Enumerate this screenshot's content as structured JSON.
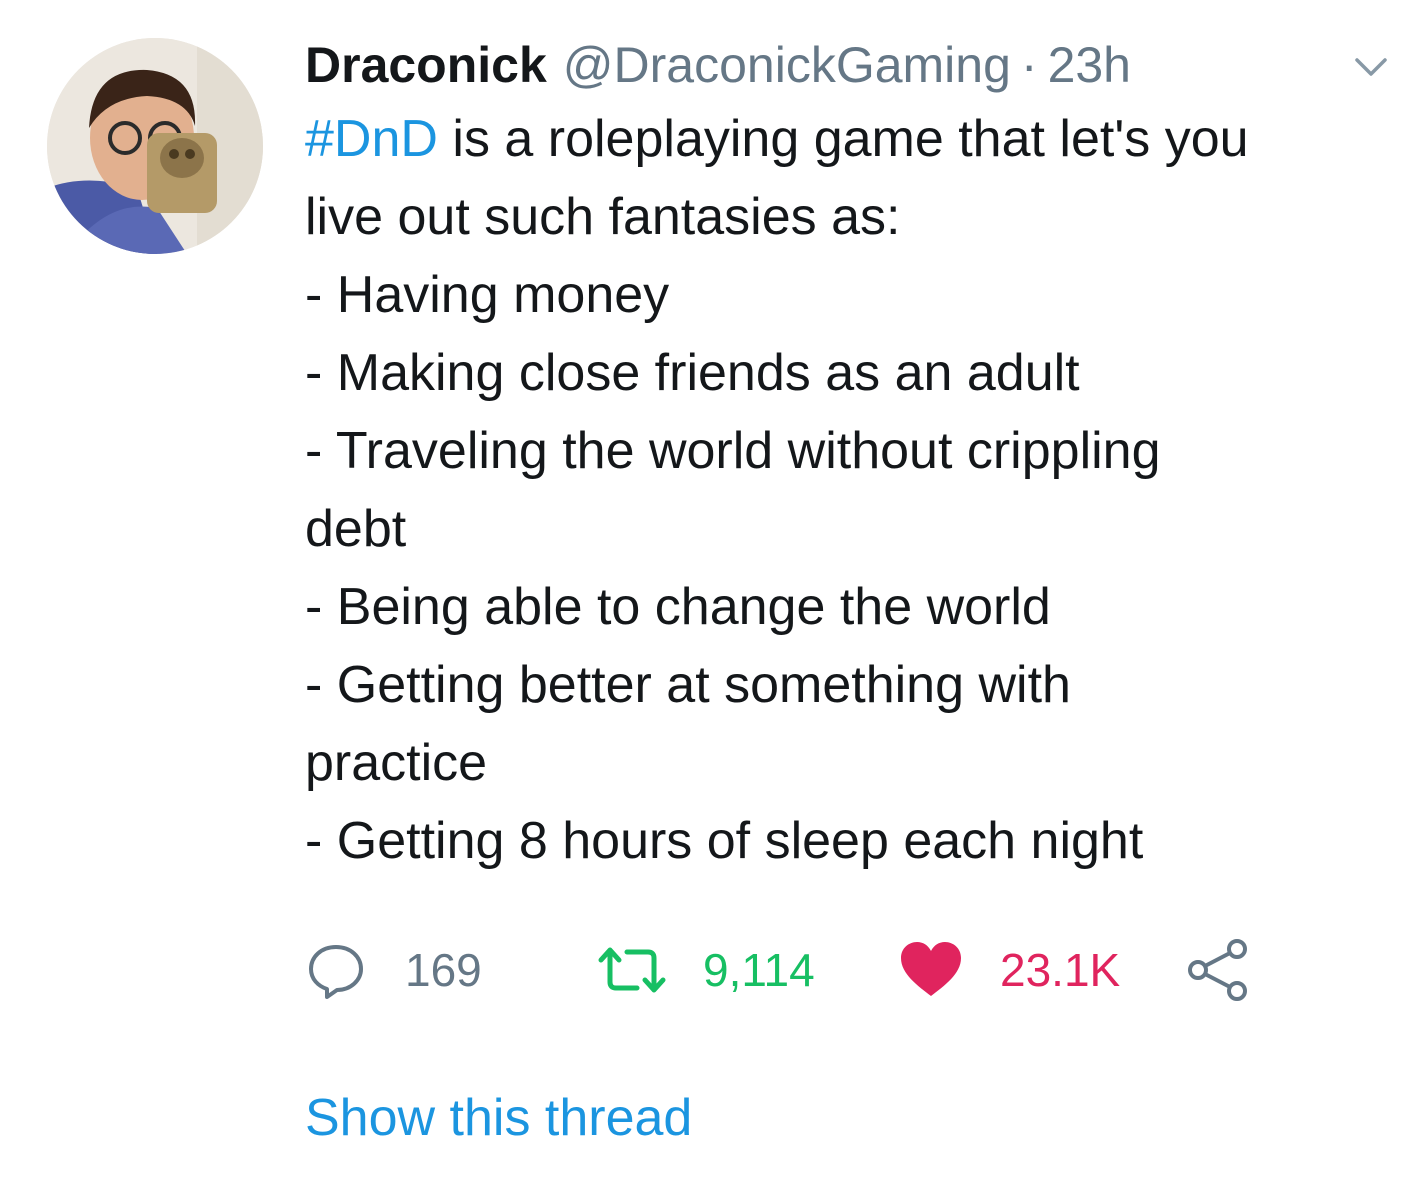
{
  "author": {
    "name": "Draconick",
    "handle": "@DraconickGaming",
    "separator": "·",
    "time": "23h"
  },
  "tweet": {
    "hashtag": "#DnD",
    "lines": {
      "l1_rest": " is a roleplaying game that let's you",
      "l2": "live out such fantasies as:",
      "l3": "- Having money",
      "l4": "- Making close friends as an adult",
      "l5": "- Traveling the world without crippling",
      "l6": "debt",
      "l7": "- Being able to change the world",
      "l8": "- Getting better at something with",
      "l9": "practice",
      "l10": "- Getting 8 hours of sleep each night"
    }
  },
  "actions": {
    "replies": "169",
    "retweets": "9,114",
    "likes": "23.1K"
  },
  "thread_link": "Show this thread",
  "icons": {
    "reply": "speech-bubble-icon",
    "retweet": "retweet-arrows-icon",
    "like": "heart-icon",
    "share": "share-icon",
    "menu": "chevron-down-icon"
  },
  "colors": {
    "text": "#14171a",
    "muted": "#657786",
    "link": "#1b95e0",
    "retweet": "#17bf63",
    "like": "#e0245e"
  }
}
